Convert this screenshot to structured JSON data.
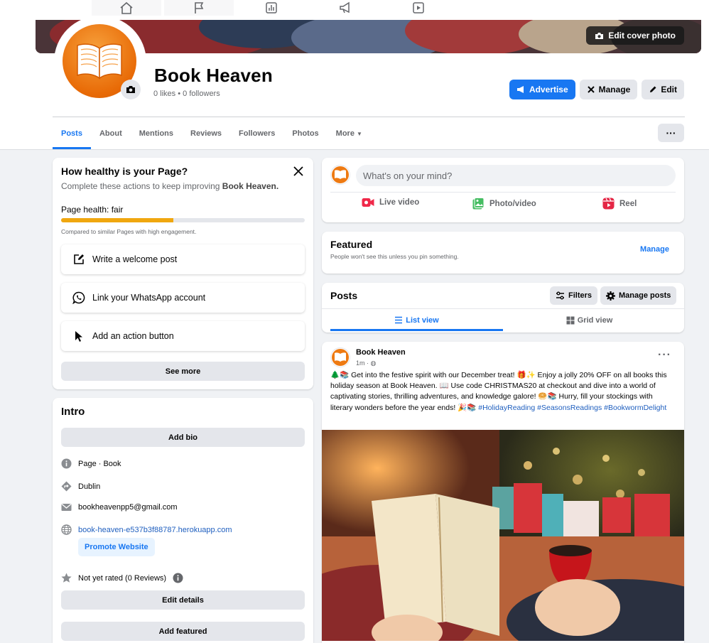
{
  "top_nav": {
    "icons": [
      "home-icon",
      "flag-icon",
      "chart-icon",
      "megaphone-icon",
      "video-icon"
    ]
  },
  "header": {
    "edit_cover_label": "Edit cover photo",
    "page_name": "Book Heaven",
    "stats": "0 likes • 0 followers",
    "buttons": {
      "advertise": "Advertise",
      "manage": "Manage",
      "edit": "Edit"
    },
    "brand_color": "#1877f2",
    "avatar_color": "#e86a06"
  },
  "tabs": [
    {
      "label": "Posts",
      "active": true
    },
    {
      "label": "About"
    },
    {
      "label": "Mentions"
    },
    {
      "label": "Reviews"
    },
    {
      "label": "Followers"
    },
    {
      "label": "Photos"
    },
    {
      "label": "More"
    }
  ],
  "health": {
    "title": "How healthy is your Page?",
    "subtitle_prefix": "Complete these actions to keep improving ",
    "subtitle_page": "Book Heaven.",
    "health_label": "Page health: fair",
    "health_level": 0.46,
    "note": "Compared to similar Pages with high engagement.",
    "actions": [
      "Write a welcome post",
      "Link your WhatsApp account",
      "Add an action button"
    ],
    "see_more": "See more"
  },
  "intro": {
    "title": "Intro",
    "add_bio": "Add bio",
    "category": "Page · Book",
    "location": "Dublin",
    "email": "bookheavenpp5@gmail.com",
    "website": "book-heaven-e537b3f88787.herokuapp.com",
    "promote": "Promote Website",
    "rating": "Not yet rated (0 Reviews)",
    "edit_details": "Edit details",
    "add_featured": "Add featured"
  },
  "composer": {
    "placeholder": "What's on your mind?",
    "live": "Live video",
    "photo": "Photo/video",
    "reel": "Reel"
  },
  "featured": {
    "title": "Featured",
    "subtitle": "People won't see this unless you pin something.",
    "manage": "Manage"
  },
  "posts": {
    "title": "Posts",
    "filters": "Filters",
    "manage_posts": "Manage posts",
    "list_view": "List view",
    "grid_view": "Grid view"
  },
  "post": {
    "author": "Book Heaven",
    "time": "1m ·",
    "text": "🌲📚 Get into the festive spirit with our December treat! 🎁✨ Enjoy a jolly 20% OFF on all books this holiday season at Book Heaven. 📖 Use code CHRISTMAS20 at checkout and dive into a world of captivating stories, thrilling adventures, and knowledge galore! 🥯📚 Hurry, fill your stockings with literary wonders before the year ends! 🎉📚",
    "hashtags": [
      "#HolidayReading",
      "#SeasonsReadings",
      "#BookwormDelight"
    ]
  }
}
